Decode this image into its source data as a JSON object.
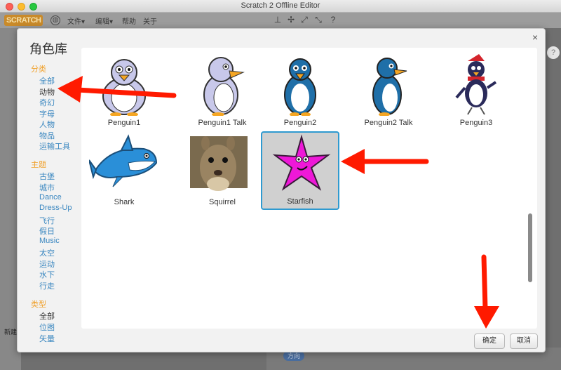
{
  "window": {
    "title": "Scratch 2 Offline Editor"
  },
  "menubar": {
    "logo": "SCRATCH",
    "items": [
      "文件▾",
      "编辑▾",
      "帮助",
      "关于"
    ]
  },
  "dialog": {
    "title": "角色库",
    "close": "×",
    "sidebar": {
      "category_heading": "分类",
      "categories": [
        "全部",
        "动物",
        "奇幻",
        "字母",
        "人物",
        "物品",
        "运输工具"
      ],
      "theme_heading": "主题",
      "themes": [
        "古堡",
        "城市",
        "Dance",
        "Dress-Up",
        "飞行",
        "假日",
        "Music",
        "太空",
        "运动",
        "水下",
        "行走"
      ],
      "type_heading": "类型",
      "types": [
        "全部",
        "位图",
        "矢量"
      ]
    },
    "sprites": [
      {
        "name": "Penguin1",
        "icon": "penguin-icon"
      },
      {
        "name": "Penguin1 Talk",
        "icon": "penguin-icon"
      },
      {
        "name": "Penguin2",
        "icon": "penguin-icon"
      },
      {
        "name": "Penguin2 Talk",
        "icon": "penguin-icon"
      },
      {
        "name": "Penguin3",
        "icon": "penguin-icon"
      },
      {
        "name": "Shark",
        "icon": "shark-icon"
      },
      {
        "name": "Squirrel",
        "icon": "squirrel-icon"
      },
      {
        "name": "Starfish",
        "icon": "starfish-icon"
      }
    ],
    "selected_sprite": "Starfish",
    "ok_label": "确定",
    "cancel_label": "取消"
  },
  "background": {
    "new_label": "新建",
    "pill_label": "方向"
  },
  "colors": {
    "accent_orange": "#f0a02a",
    "link_blue": "#3a87c0",
    "selection_border": "#2f9ad0",
    "annotation_red": "#ff1a00"
  }
}
